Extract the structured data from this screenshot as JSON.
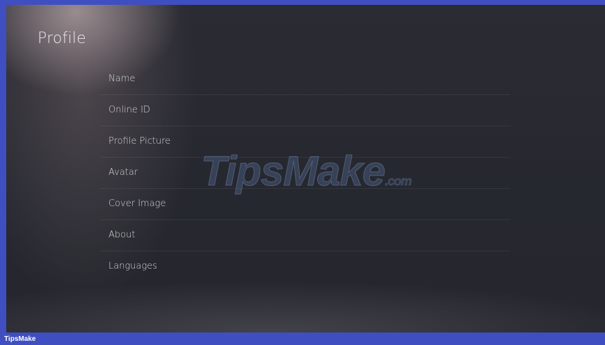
{
  "page": {
    "title": "Profile"
  },
  "menu": {
    "items": [
      {
        "label": "Name"
      },
      {
        "label": "Online ID"
      },
      {
        "label": "Profile Picture"
      },
      {
        "label": "Avatar"
      },
      {
        "label": "Cover Image"
      },
      {
        "label": "About"
      },
      {
        "label": "Languages"
      }
    ]
  },
  "watermark": {
    "main": "TipsMake",
    "suffix": ".com"
  },
  "footer": {
    "label": "TipsMake"
  },
  "colors": {
    "frame": "#3f4fc2",
    "background": "#26272e",
    "text": "#d7d7dc"
  }
}
